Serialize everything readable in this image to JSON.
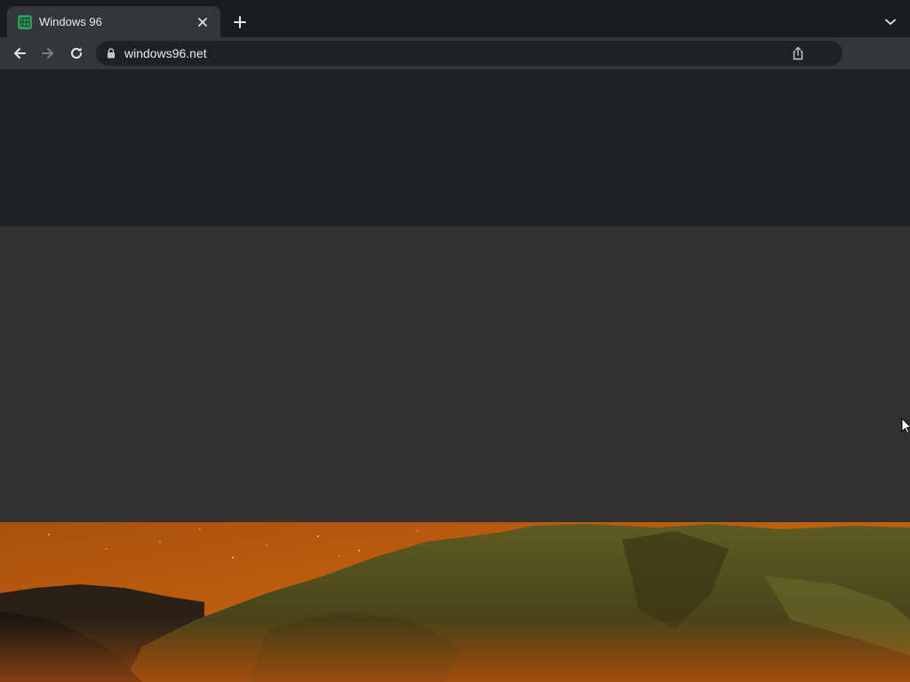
{
  "browser": {
    "tab": {
      "title": "Windows 96",
      "favicon": "windows-grid-icon",
      "favicon_color": "#2f9e5c"
    },
    "icons": {
      "close": "close-icon",
      "new_tab": "plus-icon",
      "tab_search": "chevron-down-icon",
      "back": "back-arrow-icon",
      "forward": "forward-arrow-icon",
      "reload": "reload-icon",
      "lock": "lock-icon",
      "share": "share-icon"
    },
    "address_bar": {
      "url": "windows96.net"
    }
  },
  "page": {
    "colors": {
      "top_band": "#202124",
      "loading_band": "#313131",
      "wallpaper_sky": "#b5560c",
      "wallpaper_hill": "#5d5a1e"
    },
    "wallpaper": "night-hills-wallpaper"
  }
}
